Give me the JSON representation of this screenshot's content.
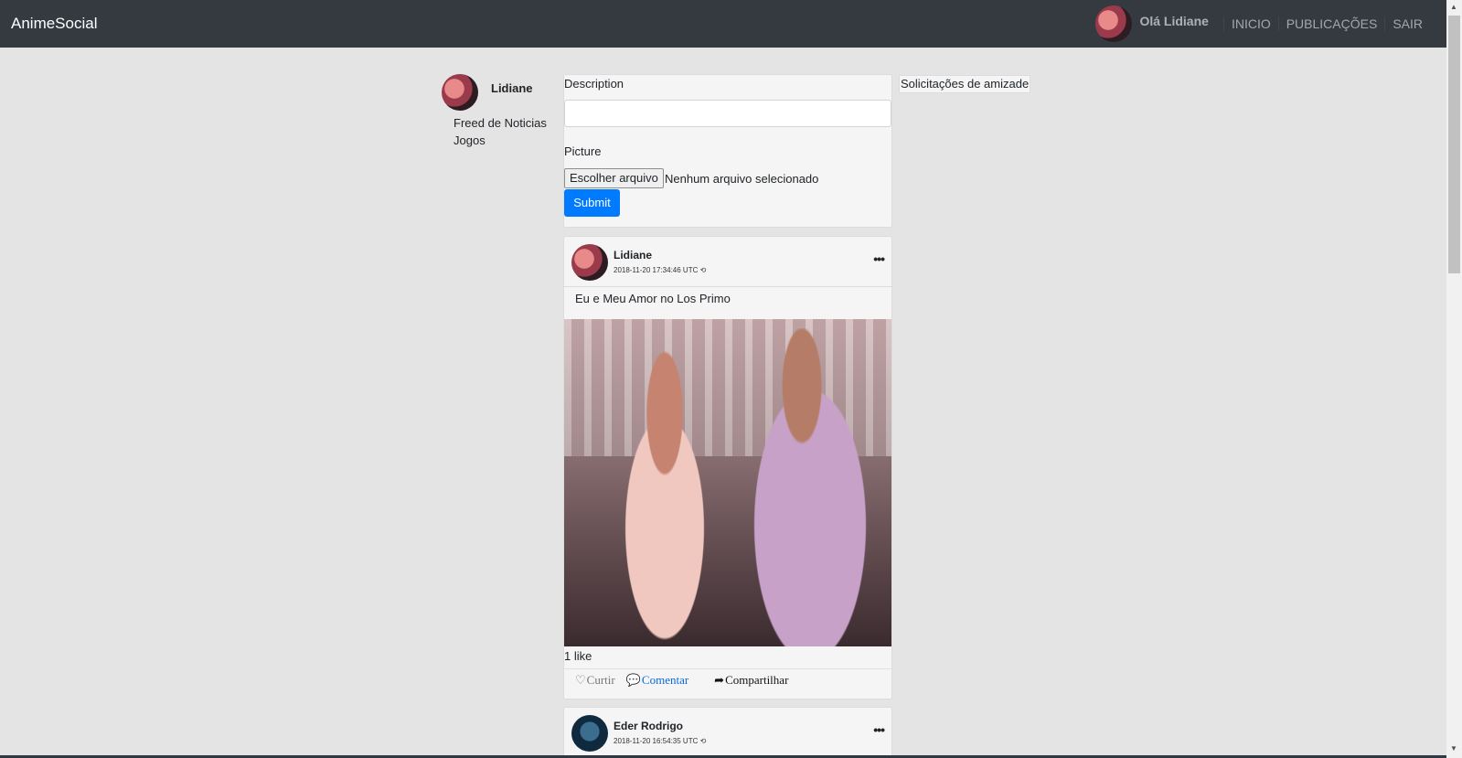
{
  "navbar": {
    "brand": "AnimeSocial",
    "greeting": "Olá Lidiane",
    "links": [
      "INICIO",
      "PUBLICAÇÕES",
      "SAIR"
    ]
  },
  "sidebar": {
    "name": "Lidiane",
    "items": [
      "Freed de Noticias",
      "Jogos"
    ]
  },
  "form": {
    "description_label": "Description",
    "description_value": "",
    "picture_label": "Picture",
    "file_button": "Escolher arquivo",
    "file_status": "Nenhum arquivo selecionado",
    "submit": "Submit"
  },
  "friend_requests_label": "Solicitações de amizade",
  "posts": [
    {
      "author": "Lidiane",
      "time": "2018-11-20 17:34:46 UTC",
      "caption": "Eu e Meu Amor no Los Primo",
      "likes": "1 like",
      "actions": {
        "like": "Curtir",
        "comment": "Comentar",
        "share": "Compartilhar"
      }
    },
    {
      "author": "Eder Rodrigo",
      "time": "2018-11-20 16:54:35 UTC"
    }
  ],
  "icons": {
    "more": "ellipsis-icon",
    "heart": "heart-icon",
    "comment": "comment-icon",
    "share": "share-icon",
    "clock": "history-icon"
  },
  "colors": {
    "navbar": "#343a40",
    "primary": "#007bff",
    "background": "#e4e4e4"
  }
}
